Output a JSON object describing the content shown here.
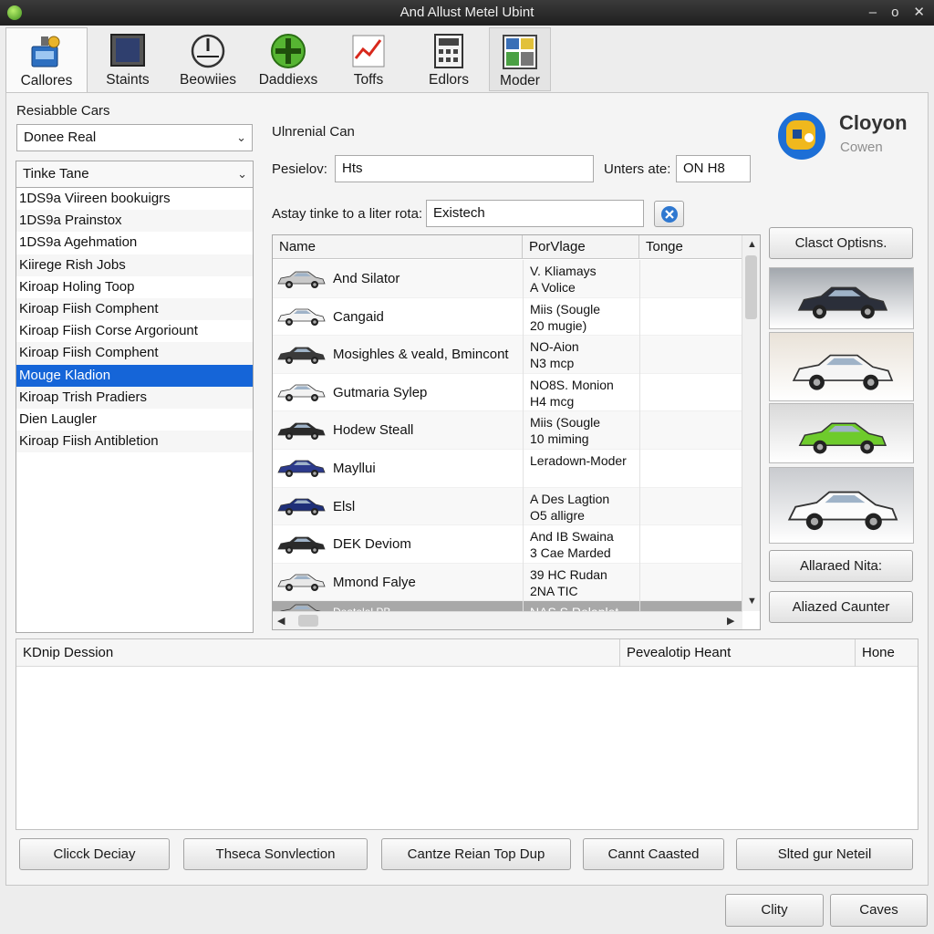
{
  "window": {
    "title": "And Allust Metel Ubint",
    "controls": [
      "–",
      "o",
      "✕"
    ]
  },
  "toolbar": [
    {
      "label": "Callores",
      "icon": "parts-icon"
    },
    {
      "label": "Staints",
      "icon": "monitor-icon"
    },
    {
      "label": "Beowiies",
      "icon": "gauge-icon"
    },
    {
      "label": "Daddiexs",
      "icon": "plus-icon"
    },
    {
      "label": "Toffs",
      "icon": "chart-icon"
    },
    {
      "label": "Edlors",
      "icon": "calculator-icon"
    },
    {
      "label": "Moder",
      "icon": "mosaic-icon"
    }
  ],
  "left": {
    "label": "Resiabble Cars",
    "combo_value": "Donee Real",
    "list_header": "Tinke Tane",
    "items": [
      "1DS9a Viireen bookuigrs",
      "1DS9a Prainstox",
      "1DS9a Agehmation",
      "Kiirege Rish Jobs",
      "Kiroap Holing Toop",
      "Kiroap Fiish Comphent",
      "Kiroap Fiish Corse Argoriount",
      "Kiroap Fiish Comphent",
      "Mouge Kladion",
      "Kiroap Trish Pradiers",
      "Dien Laugler",
      "Kiroap Fiish Antibletion"
    ],
    "selected_index": 8
  },
  "form": {
    "title": "Ulnrenial Can",
    "prefix_label": "Pesielov:",
    "prefix_value": "Hts",
    "units_label": "Unters ate:",
    "units_value": "ON H8",
    "filter_label": "Astay tinke to a liter rota:",
    "filter_value": "Existech"
  },
  "logo": {
    "name": "Cloyon",
    "sub": "Cowen"
  },
  "grid": {
    "columns": [
      "Name",
      "PorVlage",
      "Tonge"
    ],
    "rows": [
      {
        "name": "And Silator",
        "pack1": "V. Kliamays",
        "pack2": "A Volice",
        "car_color": "#c9c9c9"
      },
      {
        "name": "Cangaid",
        "pack1": "Miis (Sougle",
        "pack2": "20 mugie)",
        "car_color": "#f4f4f4"
      },
      {
        "name": "Mosighles & veald, Bmincont",
        "pack1": "NO-Aion",
        "pack2": "N3 mcp",
        "car_color": "#3a3a3a"
      },
      {
        "name": "Gutmaria Sylep",
        "pack1": "NO8S. Monion",
        "pack2": "H4 mcg",
        "car_color": "#f2f2f2"
      },
      {
        "name": "Hodew Steall",
        "pack1": "Miis (Sougle",
        "pack2": "10 miming",
        "car_color": "#2a2a2a"
      },
      {
        "name": "Mayllui",
        "pack1": "Leradown-Moder",
        "pack2": "",
        "car_color": "#2c3a8c"
      },
      {
        "name": "Elsl",
        "pack1": "A Des Lagtion",
        "pack2": "O5 alligre",
        "car_color": "#1e2f78"
      },
      {
        "name": "DEK Deviom",
        "pack1": "And IB Swaina",
        "pack2": "3 Cae Marded",
        "car_color": "#2b2b2b"
      },
      {
        "name": "Mmond Falye",
        "pack1": "39 HC Rudan",
        "pack2": "2NA TIC",
        "car_color": "#e8e8e8"
      },
      {
        "name": "Deatelal PB",
        "pack1": "NAS S Rolaplet",
        "pack2": "",
        "car_color": "#b0b0b0"
      }
    ],
    "selected_index": 9
  },
  "right": {
    "button_top": "Clasct Optisns.",
    "cars": [
      {
        "color": "#2b2f3a",
        "bg": "#a2a7ad"
      },
      {
        "color": "#f5f5f5",
        "bg": "#e9e2d8"
      },
      {
        "color": "#6ecb2c",
        "bg": "#d9d9d9"
      },
      {
        "color": "#fbfbfb",
        "bg": "#c9cbcf"
      }
    ],
    "button_mid": "Allaraed Nita:",
    "button_bottom": "Aliazed Caunter"
  },
  "bottom_table": {
    "columns": [
      "KDnip Dession",
      "Pevealotip Heant",
      "Hone"
    ]
  },
  "actions": [
    "Clicck Deciay",
    "Thseca Sonvlection",
    "Cantze Reian Top Dup",
    "Cannt Caasted",
    "Slted gur Neteil"
  ],
  "footer": {
    "ok": "Clity",
    "cancel": "Caves"
  }
}
